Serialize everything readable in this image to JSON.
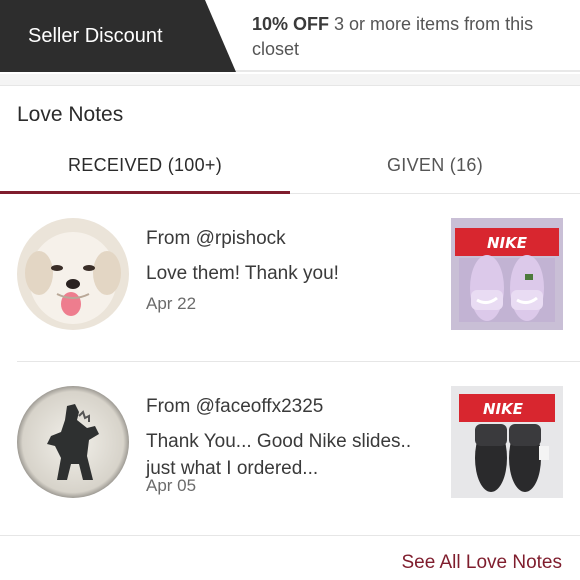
{
  "discount": {
    "tag_label": "Seller Discount",
    "offer_bold": "10% OFF",
    "offer_text": " 3 or more items from this closet"
  },
  "section": {
    "title": "Love Notes"
  },
  "tabs": [
    {
      "label": "RECEIVED (100+)",
      "active": true
    },
    {
      "label": "GIVEN (16)",
      "active": false
    }
  ],
  "notes": [
    {
      "from": "From @rpishock",
      "message": "Love them! Thank you!",
      "date": "Apr 22",
      "product_brand": "NIKE"
    },
    {
      "from": "From @faceoffx2325",
      "message": "Thank You... Good Nike slides.. just what I ordered...",
      "date": "Apr 05",
      "product_brand": "NIKE"
    }
  ],
  "footer": {
    "see_all_label": "See All Love Notes"
  },
  "colors": {
    "accent": "#7f1d2d",
    "tag_bg": "#2d2d2d",
    "nike_red": "#d8262f"
  }
}
